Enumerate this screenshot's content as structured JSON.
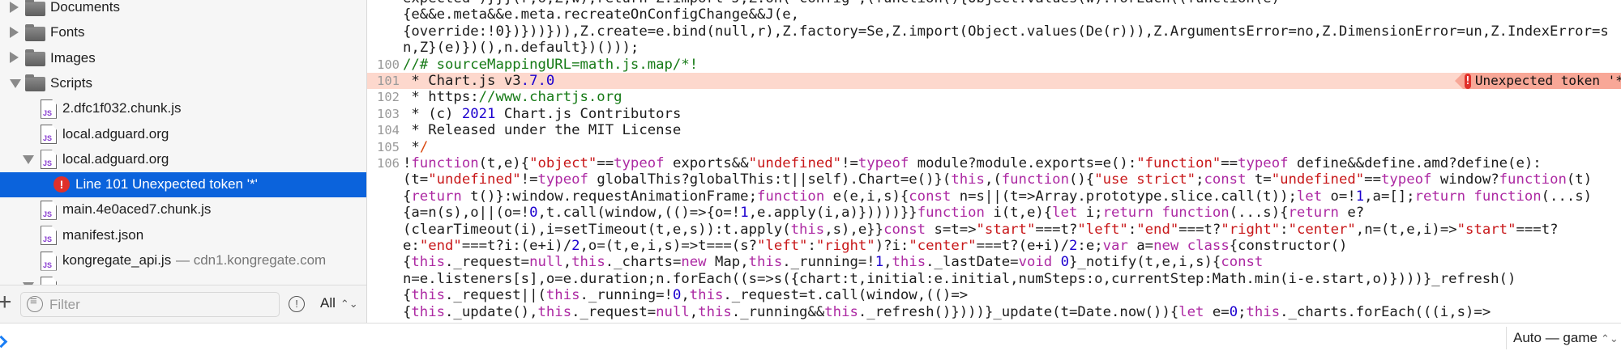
{
  "sidebar": {
    "items": [
      {
        "type": "folder",
        "label": "Documents",
        "expanded": false
      },
      {
        "type": "folder",
        "label": "Fonts",
        "expanded": false
      },
      {
        "type": "folder",
        "label": "Images",
        "expanded": false
      },
      {
        "type": "folder",
        "label": "Scripts",
        "expanded": true
      },
      {
        "type": "file",
        "label": "2.dfc1f032.chunk.js"
      },
      {
        "type": "file",
        "label": "local.adguard.org"
      },
      {
        "type": "file",
        "label": "local.adguard.org",
        "expanded": true
      },
      {
        "type": "issue",
        "label": "Line 101 Unexpected token '*'",
        "selected": true
      },
      {
        "type": "file",
        "label": "main.4e0aced7.chunk.js"
      },
      {
        "type": "file",
        "label": "manifest.json"
      },
      {
        "type": "file",
        "label": "kongregate_api.js",
        "domain": "— cdn1.kongregate.com"
      }
    ],
    "file_icon_text": "JS",
    "filter": {
      "placeholder": "Filter",
      "value": ""
    },
    "scope": "All",
    "add_label": "+",
    "issues_icon": "!"
  },
  "editor": {
    "error": {
      "line": 101,
      "message": "Unexpected token '*'"
    },
    "lines": [
      {
        "num": "",
        "segs": [
          [
            "",
            "expected\")}}}(r,o,Z,w);return Z.import=J,Z.on(\"config\",(function(){Object.values(w).forEach((function(e)"
          ]
        ]
      },
      {
        "num": "",
        "segs": [
          [
            "",
            "{e&&e.meta&&e.meta.recreateOnConfigChange&&J(e,"
          ]
        ]
      },
      {
        "num": "",
        "segs": [
          [
            "",
            "{override:!0})}))})),Z.create=e.bind(null,r),Z.factory=Se,Z.import(Object.values(De(r))),Z.ArgumentsError=no,Z.DimensionError=un,Z.IndexError=s"
          ]
        ]
      },
      {
        "num": "",
        "segs": [
          [
            "",
            "n,Z}(e)})(),n.default})()));"
          ]
        ]
      },
      {
        "num": "100",
        "segs": [
          [
            "cm",
            "//# sourceMappingURL=math.js.map/*!"
          ]
        ]
      },
      {
        "num": "101",
        "error": true,
        "segs": [
          [
            "",
            " * Chart.js v3"
          ],
          [
            "num",
            ".7.0"
          ]
        ]
      },
      {
        "num": "102",
        "segs": [
          [
            "",
            " * https:"
          ],
          [
            "cm",
            "//www.chartjs.org"
          ]
        ]
      },
      {
        "num": "103",
        "segs": [
          [
            "",
            " * (c) "
          ],
          [
            "num",
            "2021"
          ],
          [
            "",
            " Chart.js Contributors"
          ]
        ]
      },
      {
        "num": "104",
        "segs": [
          [
            "",
            " * Released under the MIT License"
          ]
        ]
      },
      {
        "num": "105",
        "segs": [
          [
            "",
            " *"
          ],
          [
            "rx",
            "/"
          ]
        ]
      },
      {
        "num": "106",
        "hl": true,
        "text": "!function(t,e){\"object\"==typeof exports&&\"undefined\"!=typeof module?module.exports=e():\"function\"==typeof define&&define.amd?define(e):"
      },
      {
        "num": "",
        "hl": true,
        "text": "(t=\"undefined\"!=typeof globalThis?globalThis:t||self).Chart=e()}(this,(function(){\"use strict\";const t=\"undefined\"==typeof window?function(t)"
      },
      {
        "num": "",
        "hl": true,
        "text": "{return t()}:window.requestAnimationFrame;function e(e,i,s){const n=s||(t=>Array.prototype.slice.call(t));let o=!1,a=[];return function(...s)"
      },
      {
        "num": "",
        "hl": true,
        "text": "{a=n(s),o||(o=!0,t.call(window,(()=>{o=!1,e.apply(i,a)}))))}}function i(t,e){let i;return function(...s){return e?"
      },
      {
        "num": "",
        "hl": true,
        "text": "(clearTimeout(i),i=setTimeout(t,e,s)):t.apply(this,s),e}}const s=t=>\"start\"===t?\"left\":\"end\"===t?\"right\":\"center\",n=(t,e,i)=>\"start\"===t?"
      },
      {
        "num": "",
        "hl": true,
        "text": "e:\"end\"===t?i:(e+i)/2,o=(t,e,i,s)=>t===(s?\"left\":\"right\")?i:\"center\"===t?(e+i)/2:e;var a=new class{constructor()"
      },
      {
        "num": "",
        "hl": true,
        "text": "{this._request=null,this._charts=new Map,this._running=!1,this._lastDate=void 0}_notify(t,e,i,s){const"
      },
      {
        "num": "",
        "hl": true,
        "text": "n=e.listeners[s],o=e.duration;n.forEach((s=>s({chart:t,initial:e.initial,numSteps:o,currentStep:Math.min(i-e.start,o)})))}_refresh()"
      },
      {
        "num": "",
        "hl": true,
        "text": "{this._request||(this._running=!0,this._request=t.call(window,(()=>"
      },
      {
        "num": "",
        "hl": true,
        "text": "{this._update(),this._request=null,this._running&&this._refresh()})))}_update(t=Date.now()){let e=0;this._charts.forEach(((i,s)=>"
      }
    ]
  },
  "console": {
    "context": "Auto — game"
  },
  "colors": {
    "selection": "#0b63dc",
    "error_line": "#fdd8cd",
    "error_badge": "#f8a797",
    "keyword": "#ad2aa3",
    "string": "#c8181a",
    "number": "#1c00cf",
    "comment": "#167a16"
  }
}
